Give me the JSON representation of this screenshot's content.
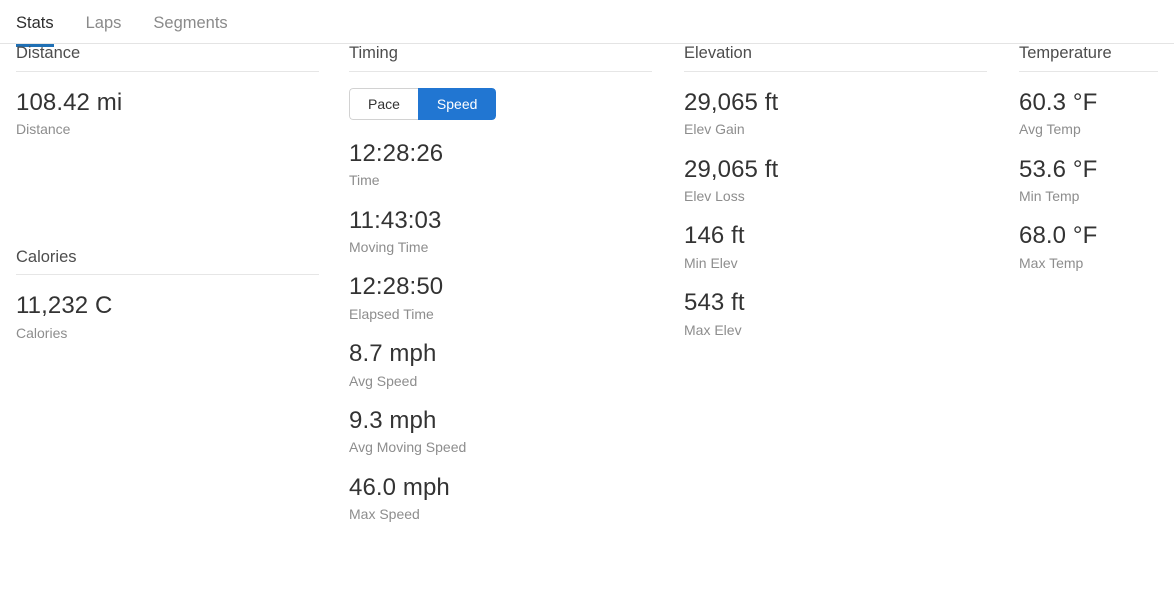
{
  "tabs": [
    {
      "label": "Stats",
      "active": true
    },
    {
      "label": "Laps",
      "active": false
    },
    {
      "label": "Segments",
      "active": false
    }
  ],
  "colors": {
    "accent": "#1f70b5",
    "toggle_active": "#2176d2",
    "value_text": "#333333",
    "label_text": "#8d8d8d",
    "divider": "#e6e6e6"
  },
  "columns": {
    "distance": {
      "title": "Distance",
      "stats": [
        {
          "value": "108.42 mi",
          "label": "Distance"
        }
      ]
    },
    "calories": {
      "title": "Calories",
      "stats": [
        {
          "value": "11,232 C",
          "label": "Calories"
        }
      ]
    },
    "timing": {
      "title": "Timing",
      "toggle": {
        "options": [
          {
            "label": "Pace",
            "active": false
          },
          {
            "label": "Speed",
            "active": true
          }
        ],
        "selected": "Speed"
      },
      "stats": [
        {
          "value": "12:28:26",
          "label": "Time"
        },
        {
          "value": "11:43:03",
          "label": "Moving Time"
        },
        {
          "value": "12:28:50",
          "label": "Elapsed Time"
        },
        {
          "value": "8.7 mph",
          "label": "Avg Speed"
        },
        {
          "value": "9.3 mph",
          "label": "Avg Moving Speed"
        },
        {
          "value": "46.0 mph",
          "label": "Max Speed"
        }
      ]
    },
    "elevation": {
      "title": "Elevation",
      "stats": [
        {
          "value": "29,065 ft",
          "label": "Elev Gain"
        },
        {
          "value": "29,065 ft",
          "label": "Elev Loss"
        },
        {
          "value": "146 ft",
          "label": "Min Elev"
        },
        {
          "value": "543 ft",
          "label": "Max Elev"
        }
      ]
    },
    "temperature": {
      "title": "Temperature",
      "stats": [
        {
          "value": "60.3 °F",
          "label": "Avg Temp"
        },
        {
          "value": "53.6 °F",
          "label": "Min Temp"
        },
        {
          "value": "68.0 °F",
          "label": "Max Temp"
        }
      ]
    }
  }
}
